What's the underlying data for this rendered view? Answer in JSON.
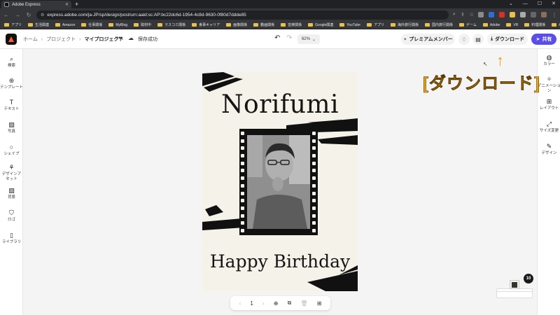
{
  "browser": {
    "tab_title": "Adobe Express",
    "url": "express.adobe.com/ja-JP/sp/design/post/urn:aaid:sc:AP:bc22dc6d-1954-4c8d-9630-0f80d7ddde85",
    "bookmarks": [
      "アプリ",
      "生活関連",
      "Amazon",
      "仕事関係",
      "MyBlog",
      "取材中",
      "マスコミ関係",
      "食事キャリア",
      "画像関係",
      "動画関係",
      "音楽関係",
      "Google関連",
      "YouTube",
      "アプリ",
      "海外旅行関係",
      "国内旅行関係",
      "ゲーム",
      "Adobe",
      "VR",
      "料理関係",
      "AI"
    ]
  },
  "header": {
    "breadcrumbs": [
      "ホーム",
      "プロジェクト",
      "マイプロジェクト"
    ],
    "save_status": "保存成功",
    "zoom": "62%",
    "premium_label": "プレミアムメンバー",
    "download_label": "ダウンロード",
    "share_label": "共有"
  },
  "left_sidebar": {
    "items": [
      {
        "label": "検索",
        "icon": "search-icon"
      },
      {
        "label": "テンプレート",
        "icon": "template-icon"
      },
      {
        "label": "テキスト",
        "icon": "text-icon"
      },
      {
        "label": "写真",
        "icon": "photo-icon"
      },
      {
        "label": "シェイプ",
        "icon": "shape-icon"
      },
      {
        "label": "デザインアセット",
        "icon": "design-assets-icon"
      },
      {
        "label": "背景",
        "icon": "background-icon"
      },
      {
        "label": "ロゴ",
        "icon": "logo-icon"
      },
      {
        "label": "ライブラリ",
        "icon": "library-icon"
      }
    ]
  },
  "right_sidebar": {
    "items": [
      {
        "label": "カラー",
        "icon": "palette-icon"
      },
      {
        "label": "アニメーション",
        "icon": "animation-icon"
      },
      {
        "label": "レイアウト",
        "icon": "layout-icon"
      },
      {
        "label": "サイズ変更",
        "icon": "resize-icon"
      },
      {
        "label": "デザイン",
        "icon": "design-icon"
      }
    ]
  },
  "poster": {
    "name": "Norifumi",
    "greeting": "Happy Birthday"
  },
  "annotation": {
    "arrow": "↑",
    "text": "[ダウンロード]",
    "color": "#e8a317"
  },
  "pagebar": {
    "page_number": "1"
  },
  "thumbnails": {
    "count": "10"
  },
  "colors": {
    "accent": "#5a4de8",
    "logo_red": "#ff5b3a"
  }
}
